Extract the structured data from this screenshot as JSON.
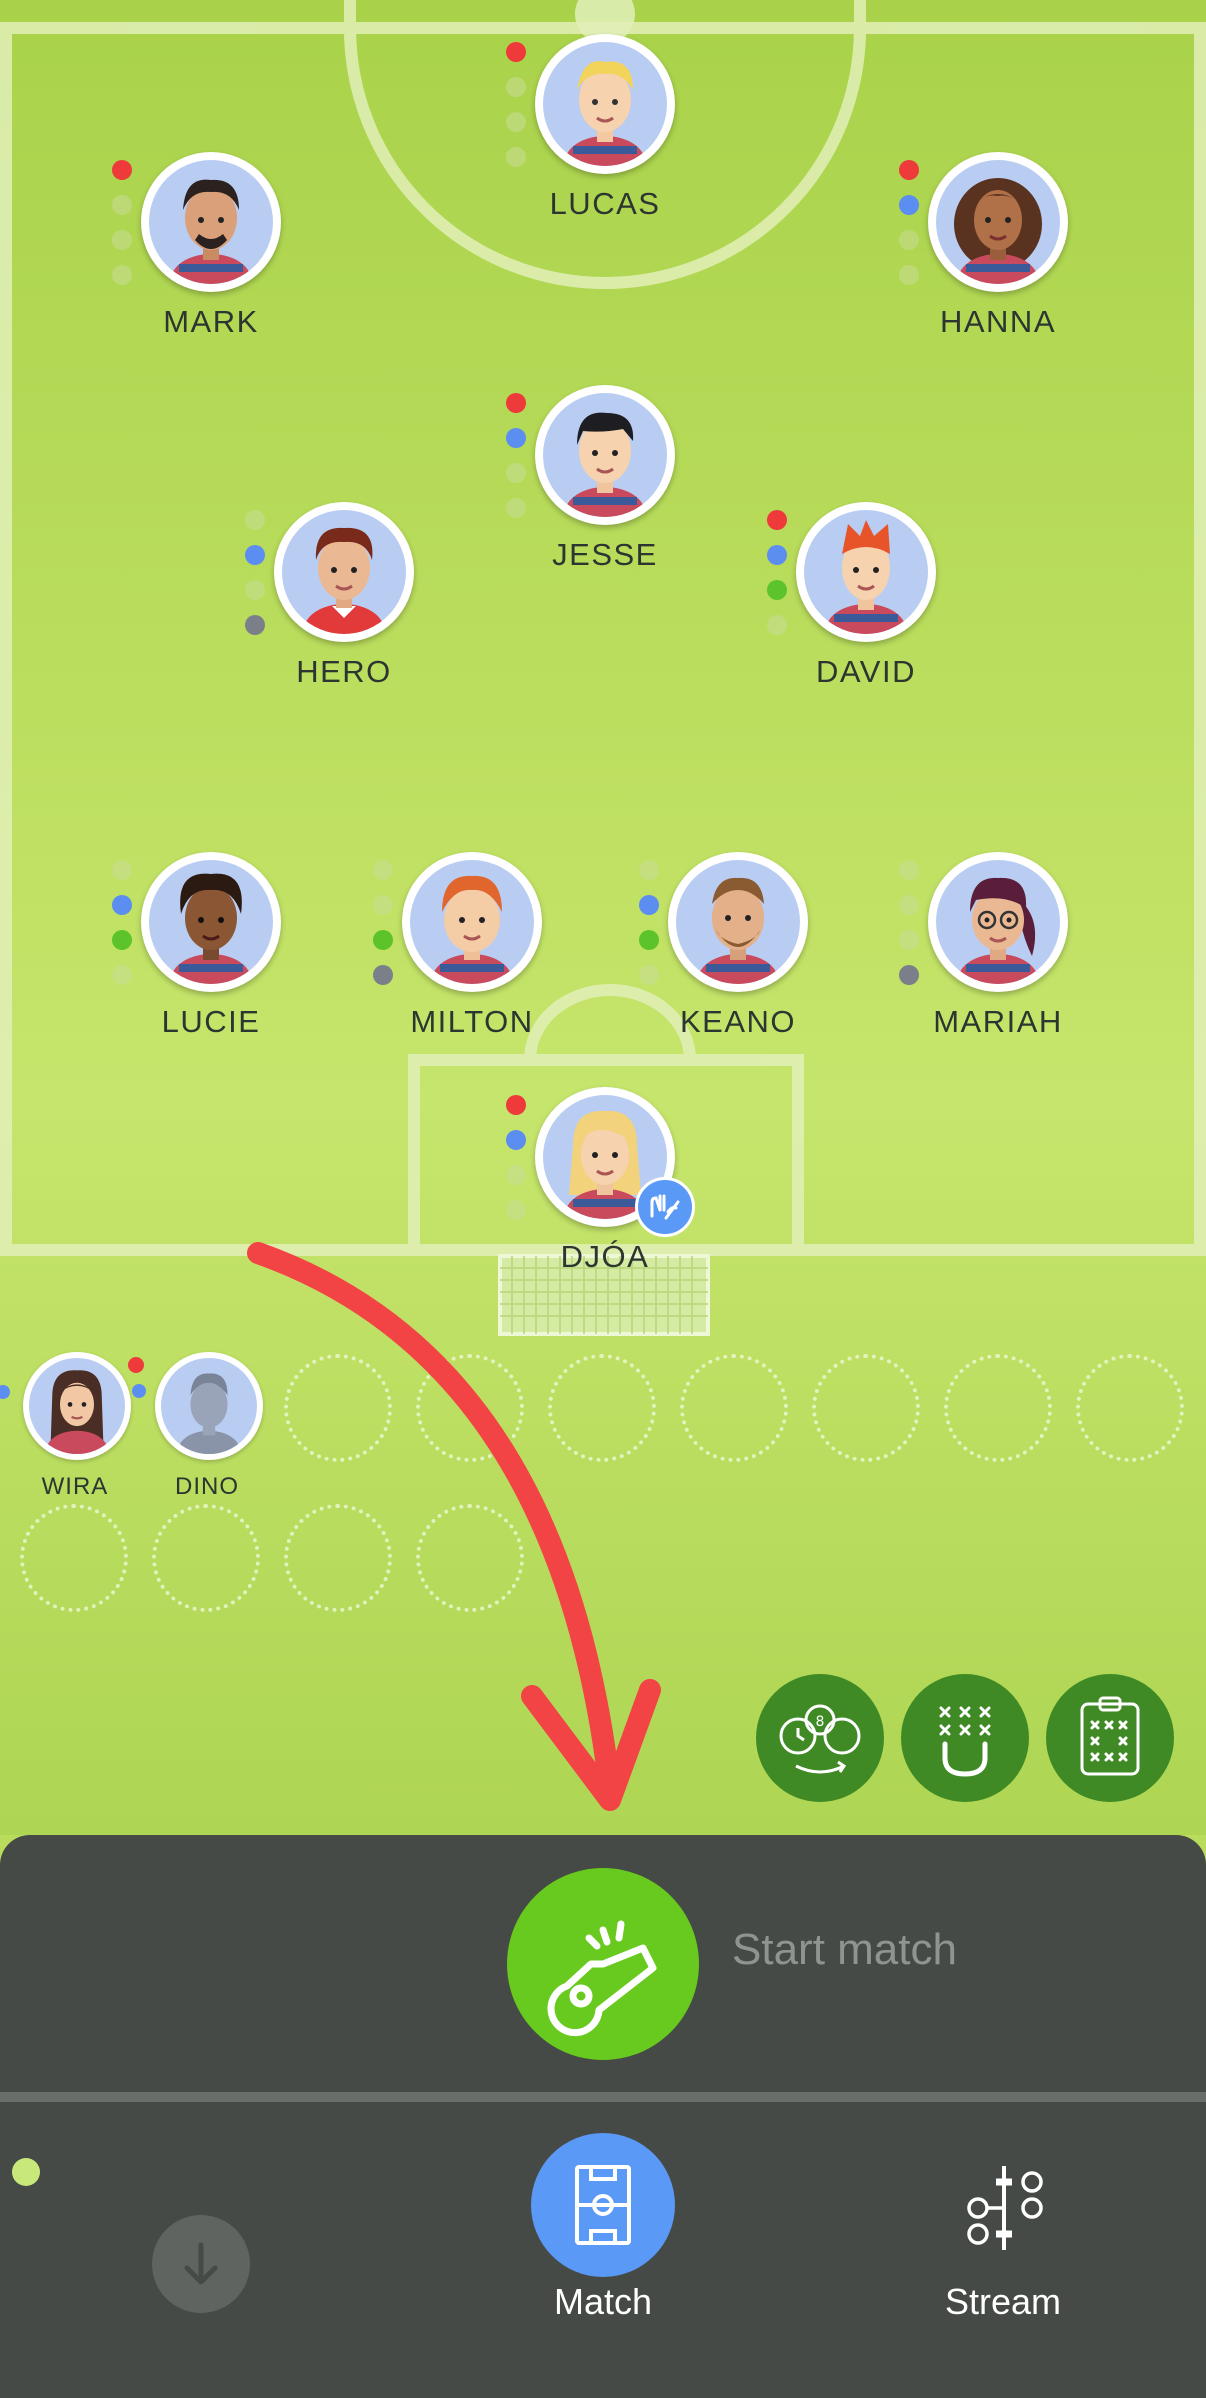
{
  "players": [
    {
      "id": "lucas",
      "name": "LUCAS",
      "dots": [
        "#ee3a3a",
        "",
        "",
        ""
      ]
    },
    {
      "id": "mark",
      "name": "MARK",
      "dots": [
        "#ee3a3a",
        "",
        "",
        ""
      ]
    },
    {
      "id": "hanna",
      "name": "HANNA",
      "dots": [
        "#ee3a3a",
        "#5b8ef0",
        "",
        ""
      ]
    },
    {
      "id": "jesse",
      "name": "JESSE",
      "dots": [
        "#ee3a3a",
        "#5b8ef0",
        "",
        ""
      ]
    },
    {
      "id": "hero",
      "name": "HERO",
      "dots": [
        "",
        "#5b8ef0",
        "",
        "#7b7f8a"
      ]
    },
    {
      "id": "david",
      "name": "DAVID",
      "dots": [
        "#ee3a3a",
        "#5b8ef0",
        "#5cc42a",
        ""
      ]
    },
    {
      "id": "lucie",
      "name": "LUCIE",
      "dots": [
        "",
        "#5b8ef0",
        "#5cc42a",
        ""
      ]
    },
    {
      "id": "milton",
      "name": "MILTON",
      "dots": [
        "",
        "",
        "#5cc42a",
        "#7b7f8a"
      ]
    },
    {
      "id": "keano",
      "name": "KEANO",
      "dots": [
        "",
        "#5b8ef0",
        "#5cc42a",
        ""
      ]
    },
    {
      "id": "mariah",
      "name": "MARIAH",
      "dots": [
        "",
        "",
        "",
        "#7b7f8a"
      ]
    },
    {
      "id": "djoa",
      "name": "DJÓA",
      "dots": [
        "#ee3a3a",
        "#5b8ef0",
        "",
        ""
      ]
    }
  ],
  "bench": {
    "players": [
      {
        "name": "WIRA"
      },
      {
        "name": "DINO"
      }
    ]
  },
  "tools": {
    "icons": [
      "rotation-icon",
      "magnet-formation-icon",
      "clipboard-icon"
    ]
  },
  "panel": {
    "start_label": "Start match"
  },
  "nav": {
    "match_label": "Match",
    "stream_label": "Stream"
  },
  "colors": {
    "red": "#ee3a3a",
    "blue": "#5b8ef0",
    "green": "#5cc42a",
    "gray": "#7b7f8a",
    "whistle_green": "#68c91e",
    "panel": "#464a46",
    "active_tab": "#5b99f7"
  }
}
